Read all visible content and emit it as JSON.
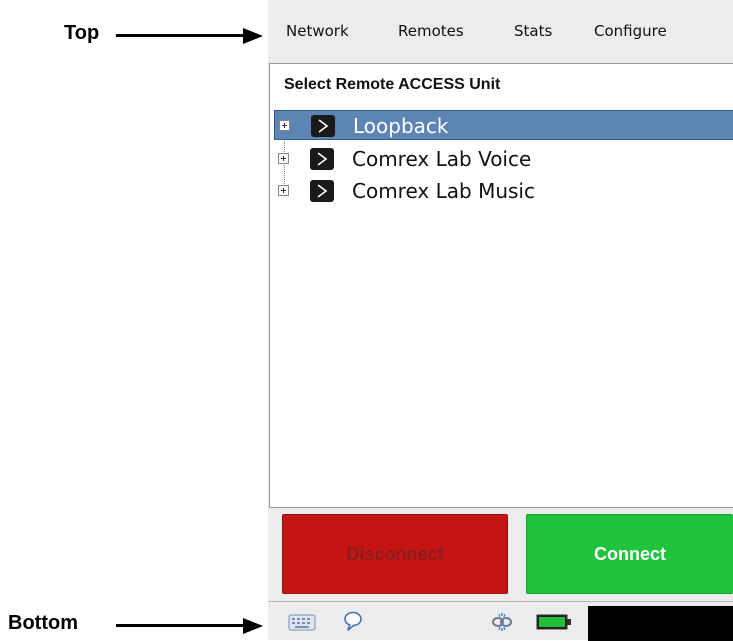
{
  "annotations": {
    "top_label": "Top",
    "bottom_label": "Bottom"
  },
  "menu": {
    "items": [
      "Network",
      "Remotes",
      "Stats",
      "Configure"
    ]
  },
  "panel": {
    "title": "Select Remote ACCESS Unit",
    "items": [
      {
        "label": "Loopback",
        "selected": true,
        "icon": "terminal-icon"
      },
      {
        "label": "Comrex Lab Voice",
        "selected": false,
        "icon": "terminal-icon"
      },
      {
        "label": "Comrex Lab Music",
        "selected": false,
        "icon": "terminal-icon"
      }
    ]
  },
  "buttons": {
    "disconnect_label": "Disconnect",
    "connect_label": "Connect"
  },
  "statusbar": {
    "icons": [
      "keyboard-icon",
      "chat-icon",
      "link-icon",
      "battery-icon"
    ]
  },
  "colors": {
    "selection": "#5c85b4",
    "disconnect": "#c41414",
    "connect": "#1fc33c",
    "battery": "#22c03a"
  }
}
